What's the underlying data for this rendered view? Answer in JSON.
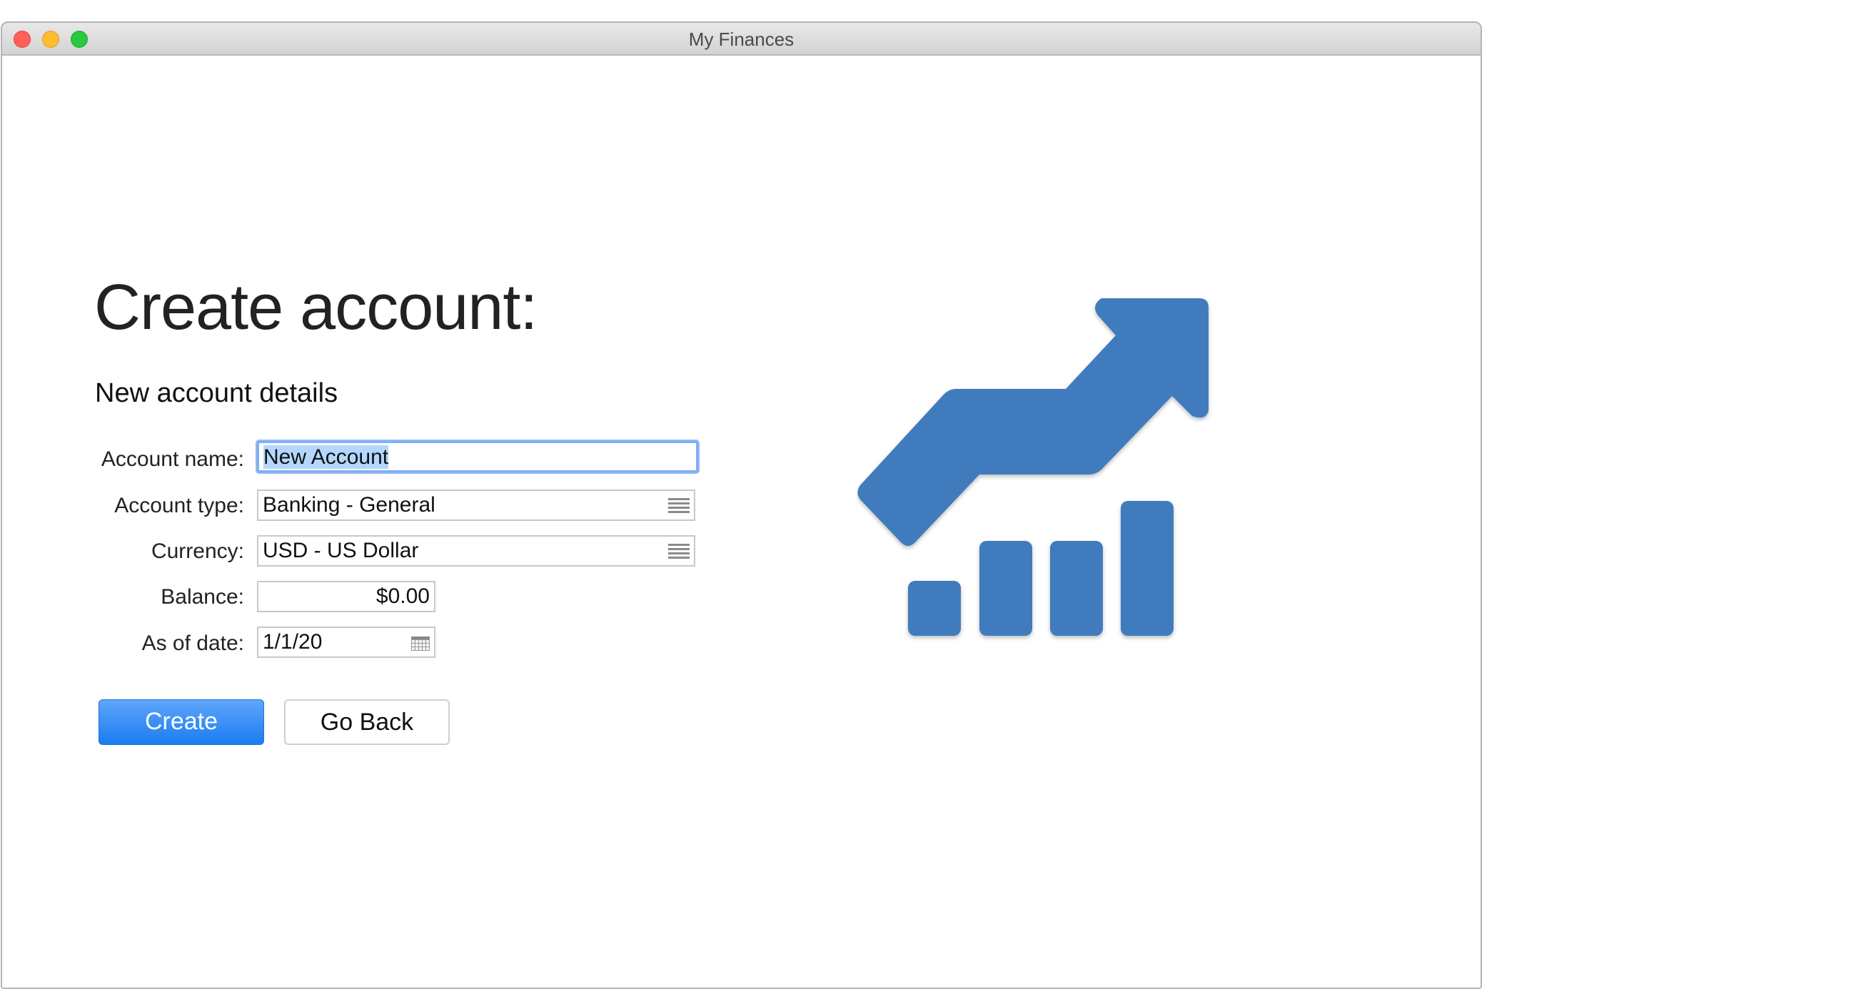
{
  "window": {
    "title": "My Finances"
  },
  "main": {
    "heading": "Create account:",
    "subheading": "New account details",
    "form": {
      "account_name": {
        "label": "Account name:",
        "value": "New Account"
      },
      "account_type": {
        "label": "Account type:",
        "value": "Banking - General",
        "icon": "list-icon"
      },
      "currency": {
        "label": "Currency:",
        "value": "USD - US Dollar",
        "icon": "list-icon"
      },
      "balance": {
        "label": "Balance:",
        "value": "$0.00"
      },
      "as_of_date": {
        "label": "As of date:",
        "value": "1/1/20",
        "icon": "calendar-icon"
      }
    },
    "buttons": {
      "create": "Create",
      "go_back": "Go Back"
    }
  },
  "illustration": {
    "icon": "growth-chart-icon",
    "color": "#407bbd"
  },
  "colors": {
    "accent": "#1b7cf0",
    "focus_ring": "#7fb0f5",
    "selection": "#b3d7ff"
  }
}
